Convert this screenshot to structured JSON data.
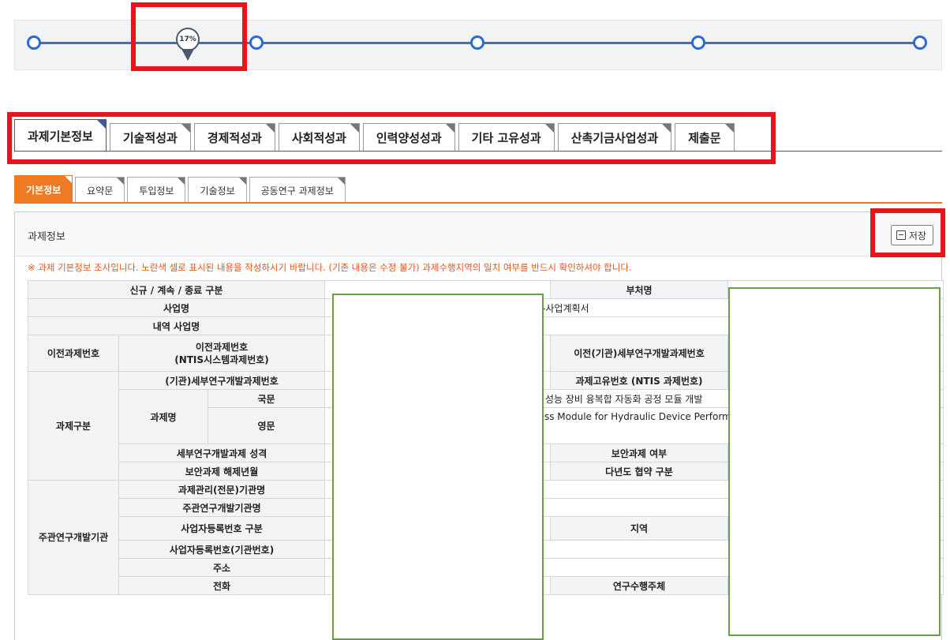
{
  "progress": {
    "percent_label": "17%",
    "percent": 17,
    "nodes": 6
  },
  "main_tabs": [
    {
      "label": "과제기본정보",
      "active": true
    },
    {
      "label": "기술적성과",
      "active": false
    },
    {
      "label": "경제적성과",
      "active": false
    },
    {
      "label": "사회적성과",
      "active": false
    },
    {
      "label": "인력양성성과",
      "active": false
    },
    {
      "label": "기타 고유성과",
      "active": false
    },
    {
      "label": "산촉기금사업성과",
      "active": false
    },
    {
      "label": "제출문",
      "active": false
    }
  ],
  "sub_tabs": [
    {
      "label": "기본정보",
      "active": true
    },
    {
      "label": "요약문",
      "active": false
    },
    {
      "label": "투입정보",
      "active": false
    },
    {
      "label": "기술정보",
      "active": false
    },
    {
      "label": "공동연구 과제정보",
      "active": false
    }
  ],
  "panel": {
    "title": "과제정보",
    "save_label": "저장",
    "notice": "※ 과제 기본정보 조사입니다. 노란색 셀로 표시된 내용을 작성하시기 바랍니다. (기존 내용은 수정 불가) 과제수행지역의 일치 여부를 반드시 확인하셔야 합니다."
  },
  "table": {
    "r1": {
      "label": "신규 / 계속 / 종료 구분",
      "right_label": "부처명"
    },
    "r2": {
      "label": "사업명",
      "value": "상-사업계획서"
    },
    "r3": {
      "label": "내역 사업명"
    },
    "r4": {
      "group": "이전과제번호",
      "label": "이전과제번호\n(NTIS시스템과제번호)",
      "right_label": "이전(기관)세부연구개발과제번호"
    },
    "r5": {
      "group": "과제구분",
      "label": "(기관)세부연구개발과제번호",
      "right_label": "과제고유번호 (NTIS 과제번호)"
    },
    "r6": {
      "sub": "과제명",
      "lang": "국문",
      "value": "스 성능 장비 융복합 자동화 공정 모듈 개발"
    },
    "r7": {
      "lang": "영문",
      "value": "cess Module for Hydraulic Device Perform"
    },
    "r8": {
      "label": "세부연구개발과제 성격",
      "right_label": "보안과제 여부"
    },
    "r9": {
      "label": "보안과제 해제년월",
      "right_label": "다년도 협약 구분"
    },
    "r10": {
      "group": "주관연구개발기관",
      "label": "과제관리(전문)기관명"
    },
    "r11": {
      "label": "주관연구개발기관명"
    },
    "r12": {
      "label": "사업자등록번호 구분",
      "right_label": "지역"
    },
    "r13": {
      "label": "사업자등록번호(기관번호)"
    },
    "r14": {
      "label": "주소"
    },
    "r15": {
      "label": "전화",
      "right_label": "연구수행주체"
    }
  },
  "colors": {
    "accent_orange": "#ef7a24",
    "highlight_red": "#e8141c",
    "highlight_green": "#6aa040",
    "progress_blue": "#2b6bd1"
  }
}
